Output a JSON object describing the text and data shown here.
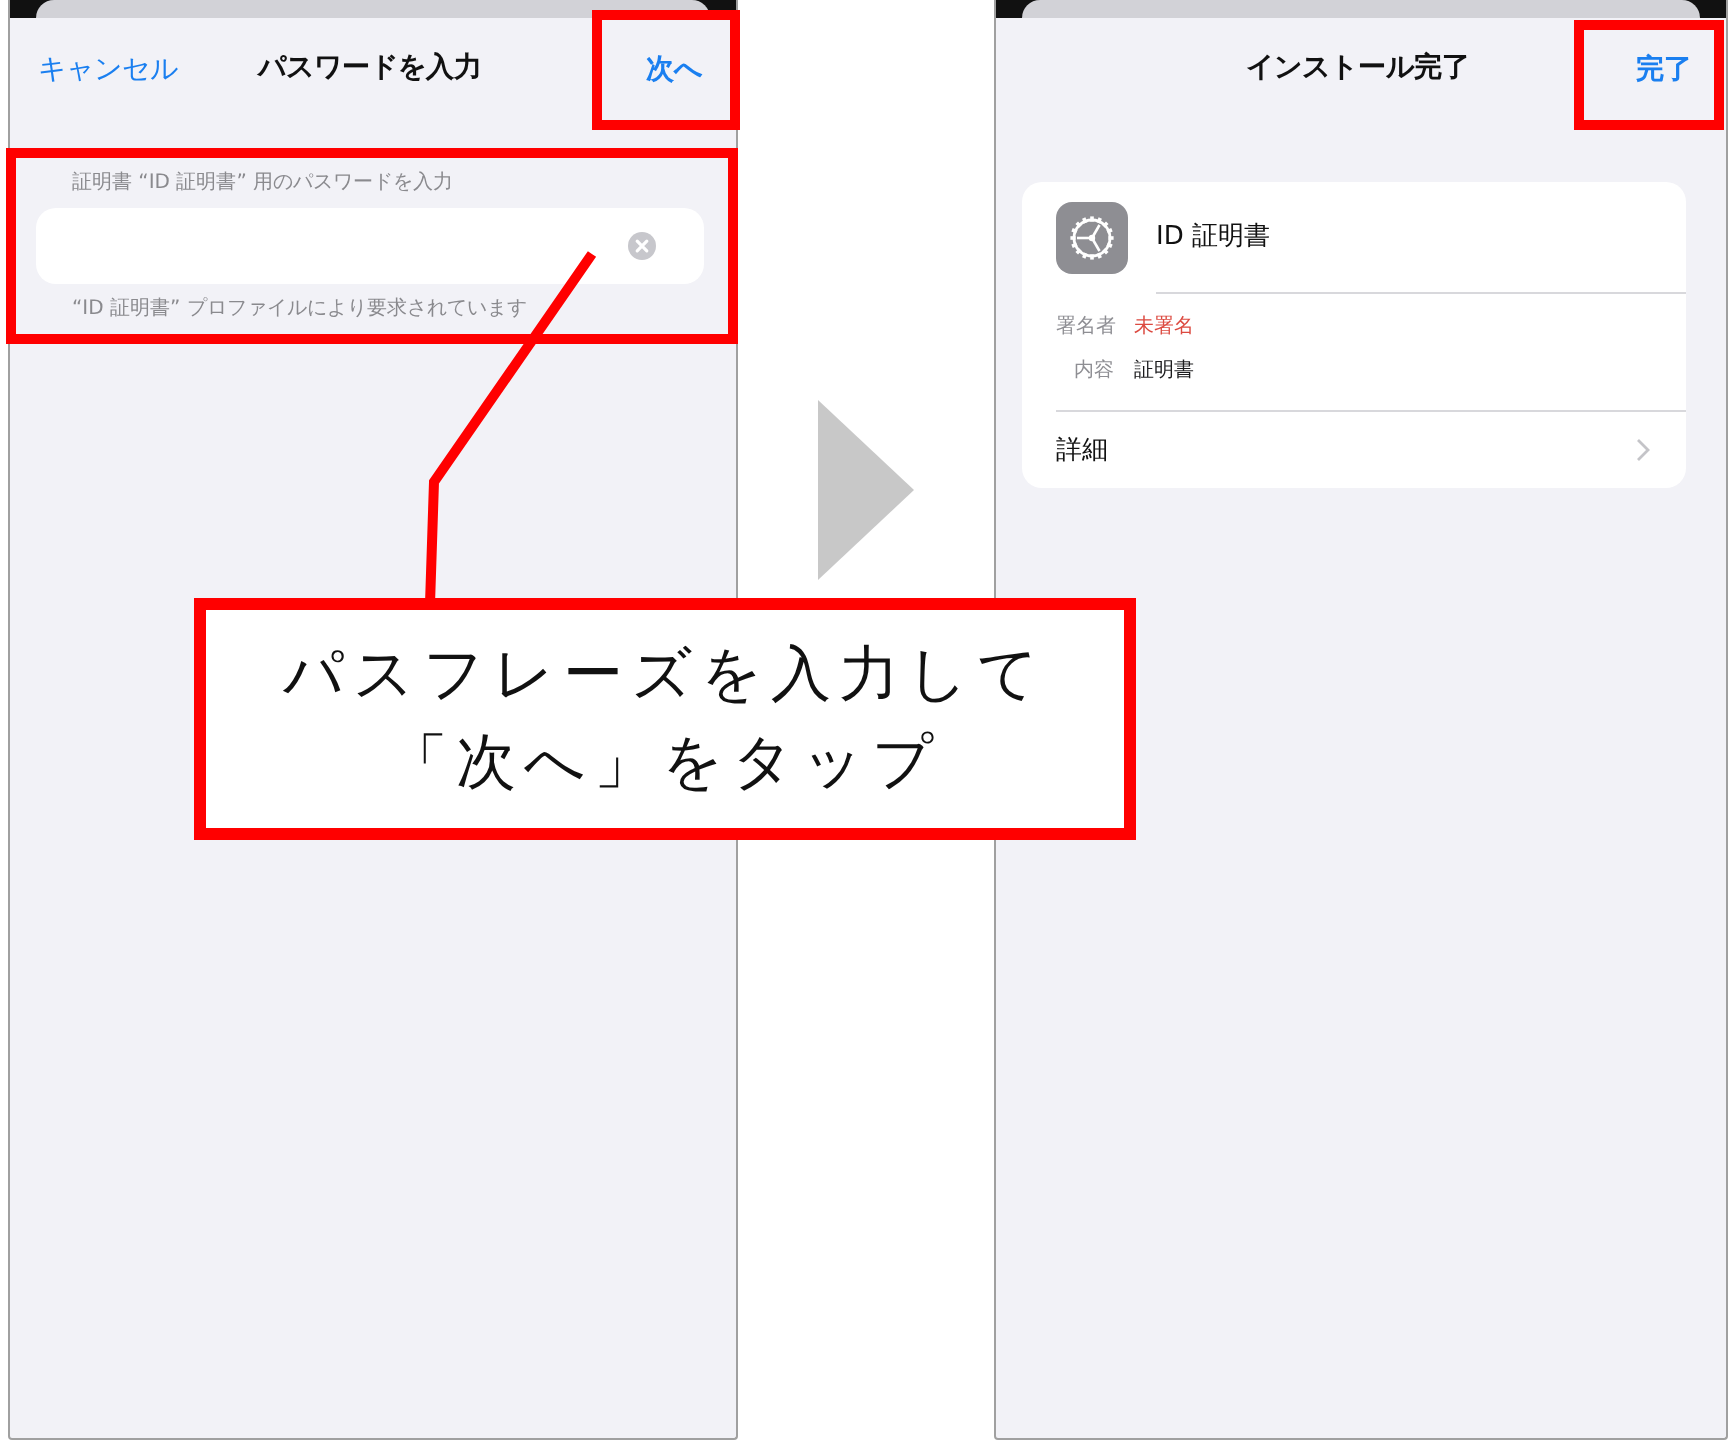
{
  "screens": [
    {
      "kind": "password_entry",
      "nav": {
        "cancel": "キャンセル",
        "title": "パスワードを入力",
        "action": "次へ",
        "action_highlighted": true
      },
      "section": {
        "header": "証明書 “ID 証明書” 用のパスワードを入力",
        "footer": "“ID 証明書” プロファイルにより要求されています",
        "highlighted": true
      }
    },
    {
      "kind": "install_complete",
      "nav": {
        "title": "インストール完了",
        "action": "完了",
        "action_highlighted": true
      },
      "profile": {
        "name": "ID 証明書",
        "details": [
          {
            "label": "署名者",
            "value": "未署名",
            "color": "#dc4a40"
          },
          {
            "label": "内容",
            "value": "証明書",
            "color": "#1c1c1e"
          }
        ],
        "more": "詳細"
      }
    }
  ],
  "callout": {
    "lines": [
      "パスフレーズを入力して",
      "「次へ」をタップ"
    ]
  }
}
